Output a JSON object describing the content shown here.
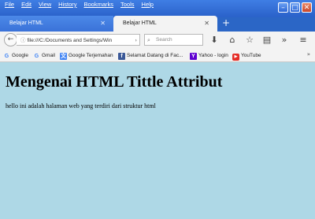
{
  "menu": [
    "File",
    "Edit",
    "View",
    "History",
    "Bookmarks",
    "Tools",
    "Help"
  ],
  "tabs": [
    {
      "title": "Belajar HTML",
      "active": false
    },
    {
      "title": "Belajar HTML",
      "active": true
    }
  ],
  "new_tab_symbol": "+",
  "nav": {
    "url": "file:///C:/Documents and Settings/Win",
    "search_placeholder": "Search"
  },
  "bookmarks": [
    {
      "label": "Google",
      "icon": "G",
      "color": "#4285f4"
    },
    {
      "label": "Gmail",
      "icon": "G",
      "color": "#4285f4"
    },
    {
      "label": "Google Terjemahan",
      "icon": "文",
      "color": "#4285f4"
    },
    {
      "label": "Selamat Datang di Fac...",
      "icon": "f",
      "color": "#3b5998"
    },
    {
      "label": "Yahoo - login",
      "icon": "Y",
      "color": "#5f01d1"
    },
    {
      "label": "YouTube",
      "icon": "▶",
      "color": "#e52d27"
    }
  ],
  "page": {
    "heading": "Mengenai HTML Tittle Attribut",
    "paragraph": "hello ini adalah halaman web yang terdiri dari struktur html",
    "background": "#aed8e6"
  }
}
